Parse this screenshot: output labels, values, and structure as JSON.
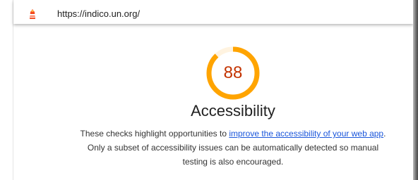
{
  "browser": {
    "url": "https://indico.un.org/"
  },
  "score": {
    "value": "88",
    "fraction": 0.88,
    "color": "#c33300",
    "ring_color": "#ffa400",
    "track_color": "#fff3e0"
  },
  "category": {
    "title": "Accessibility",
    "description_before": "These checks highlight opportunities to ",
    "description_link": "improve the accessibility of your web app",
    "description_after": ". Only a subset of accessibility issues can be automatically detected so manual testing is also encouraged."
  },
  "icons": {
    "site_logo": "lighthouse-icon"
  }
}
